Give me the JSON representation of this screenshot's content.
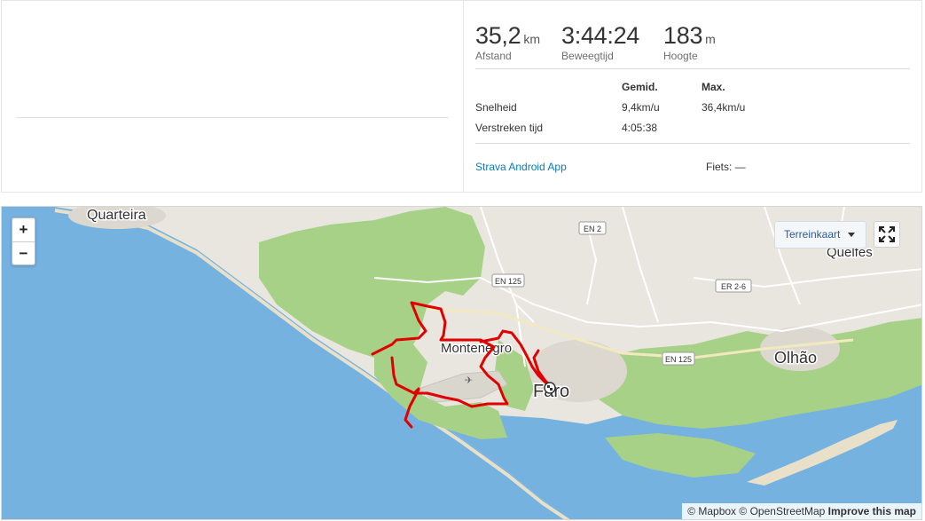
{
  "summary": {
    "stats": [
      {
        "value": "35,2",
        "unit": "km",
        "label": "Afstand"
      },
      {
        "value": "3:44:24",
        "unit": "",
        "label": "Beweegtijd"
      },
      {
        "value": "183",
        "unit": "m",
        "label": "Hoogte"
      }
    ],
    "table": {
      "col_avg": "Gemid.",
      "col_max": "Max.",
      "rows": [
        {
          "label": "Snelheid",
          "avg": "9,4km/u",
          "max": "36,4km/u"
        },
        {
          "label": "Verstreken tijd",
          "avg": "4:05:38",
          "max": ""
        }
      ]
    },
    "device": "Strava Android App",
    "gear": "Fiets: —"
  },
  "map": {
    "zoom_in": "+",
    "zoom_out": "−",
    "map_type": "Terreinkaart",
    "attribution": {
      "mapbox": "© Mapbox",
      "osm": "© OpenStreetMap",
      "improve": "Improve this map"
    },
    "places": {
      "quarteira": "Quarteira",
      "montenegro": "Montenegro",
      "faro": "Faro",
      "olhao": "Olhão",
      "quelfes": "Quelfes"
    },
    "roads": {
      "en2": "EN 2",
      "en125_a": "EN 125",
      "en125_b": "EN 125",
      "er26": "ER 2-6"
    },
    "colors": {
      "water": "#75b2e0",
      "land": "#e9e6e0",
      "park": "#a8d188",
      "route": "#e00000"
    }
  }
}
